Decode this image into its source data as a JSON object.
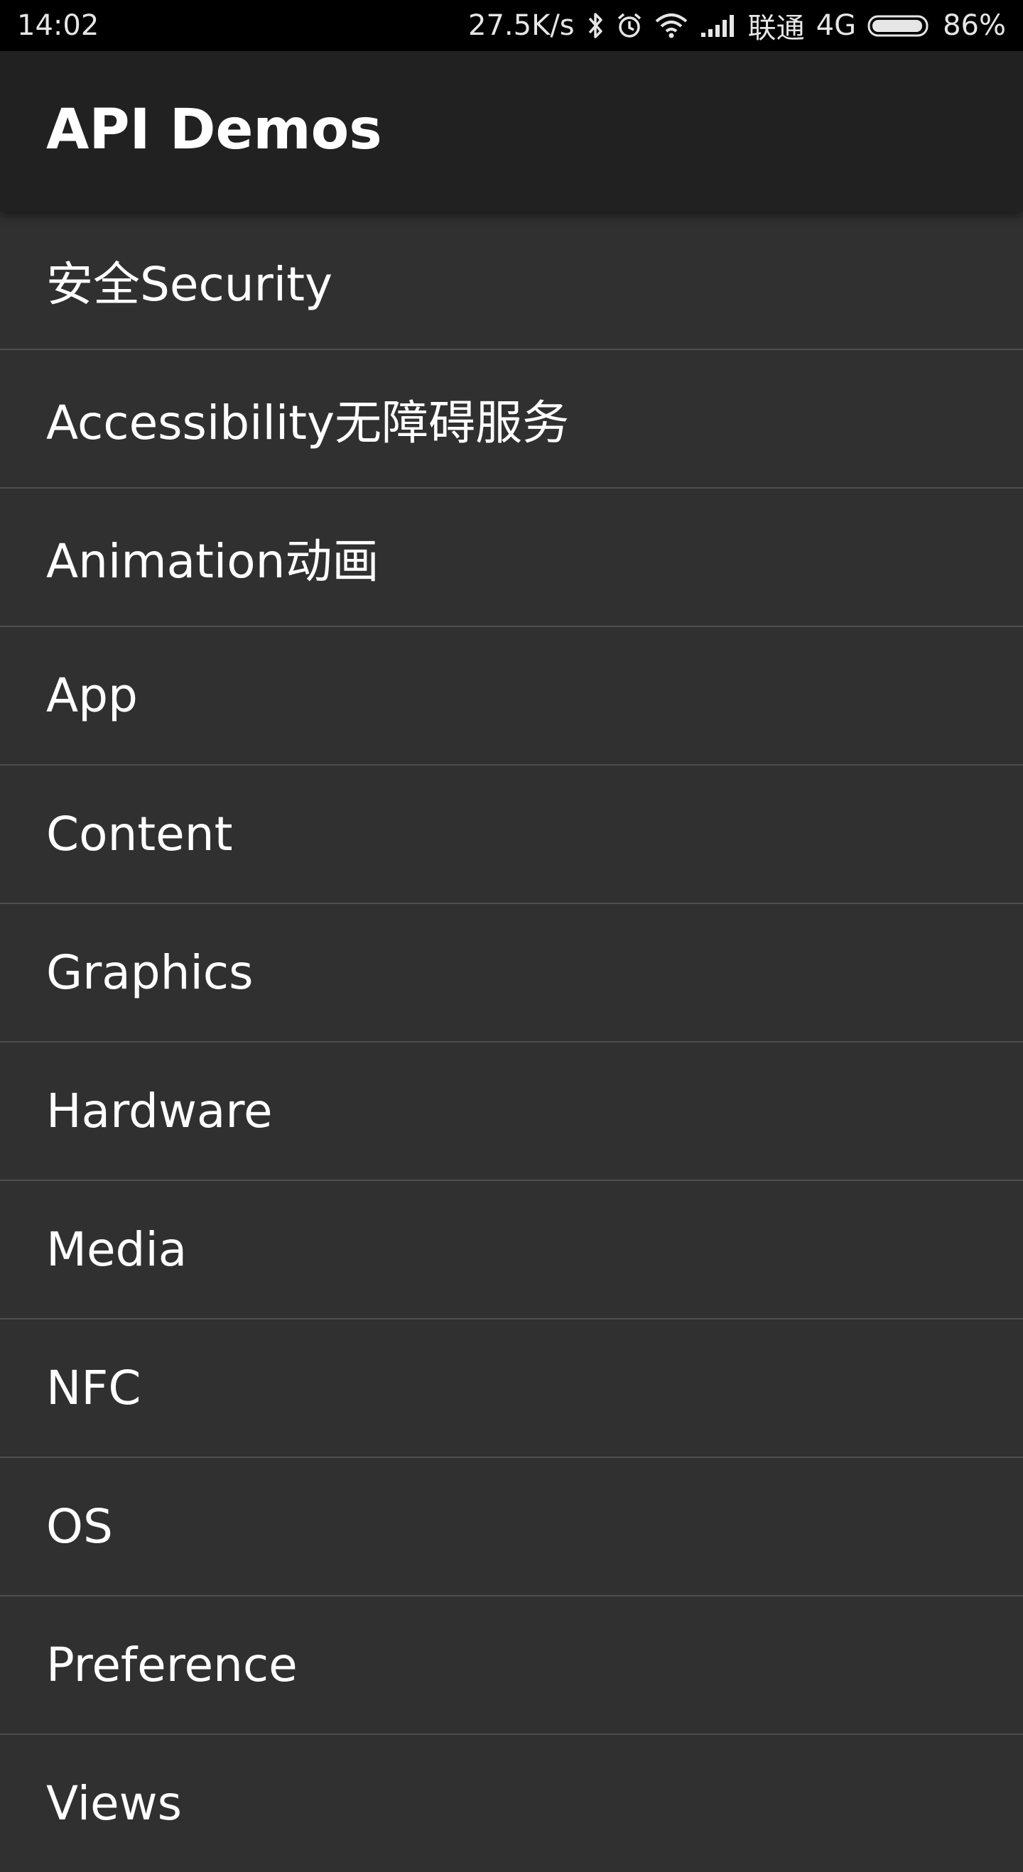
{
  "status_bar": {
    "time": "14:02",
    "network_speed": "27.5K/s",
    "carrier": "联通",
    "network_type": "4G",
    "battery_percent": "86%",
    "icons": [
      "bluetooth-icon",
      "alarm-icon",
      "wifi-icon",
      "signal-icon",
      "battery-icon"
    ]
  },
  "app_bar": {
    "title": "API Demos"
  },
  "list": {
    "items": [
      {
        "label": "安全Security"
      },
      {
        "label": "Accessibility无障碍服务"
      },
      {
        "label": "Animation动画"
      },
      {
        "label": "App"
      },
      {
        "label": "Content"
      },
      {
        "label": "Graphics"
      },
      {
        "label": "Hardware"
      },
      {
        "label": "Media"
      },
      {
        "label": "NFC"
      },
      {
        "label": "OS"
      },
      {
        "label": "Preference"
      },
      {
        "label": "Views"
      }
    ]
  },
  "colors": {
    "status_bar_bg": "#000000",
    "app_bar_bg": "#212121",
    "list_bg": "#303030",
    "divider": "#4e4e4e",
    "text": "#ffffff"
  }
}
